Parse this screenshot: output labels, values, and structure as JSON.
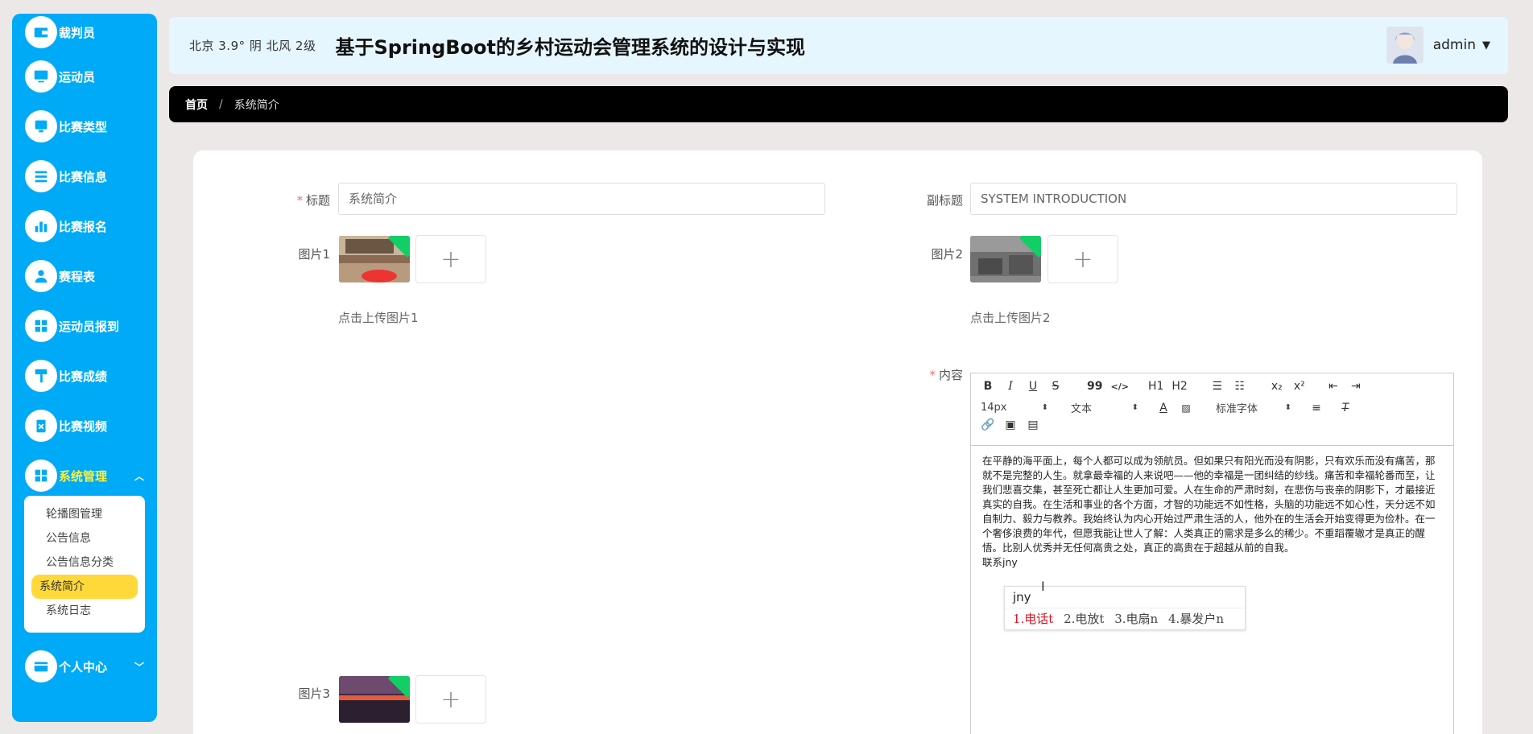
{
  "sidebar": {
    "items": [
      {
        "label": "裁判员",
        "icon": "wallet-icon"
      },
      {
        "label": "运动员",
        "icon": "monitor-icon"
      },
      {
        "label": "比赛类型",
        "icon": "screen-icon"
      },
      {
        "label": "比赛信息",
        "icon": "list-icon"
      },
      {
        "label": "比赛报名",
        "icon": "bar-chart-icon"
      },
      {
        "label": "赛程表",
        "icon": "user-icon"
      },
      {
        "label": "运动员报到",
        "icon": "grid-icon"
      },
      {
        "label": "比赛成绩",
        "icon": "paint-roller-icon"
      },
      {
        "label": "比赛视频",
        "icon": "clipboard-x-icon"
      },
      {
        "label": "系统管理",
        "icon": "grid-icon"
      },
      {
        "label": "个人中心",
        "icon": "card-icon"
      }
    ],
    "submenu": [
      "轮播图管理",
      "公告信息",
      "公告信息分类",
      "系统简介",
      "系统日志"
    ],
    "active_sub": "系统简介",
    "colors": {
      "bg": "#00aaf6",
      "active_text": "#ffef3a",
      "active_sub_bg": "#ffd93a"
    }
  },
  "header": {
    "weather": "北京  3.9°  阴  北风  2级",
    "title": "基于SpringBoot的乡村运动会管理系统的设计与实现",
    "user": "admin"
  },
  "breadcrumb": {
    "home": "首页",
    "sep": "/",
    "current": "系统简介"
  },
  "form": {
    "title_label": "标题",
    "title_value": "系统简介",
    "subtitle_label": "副标题",
    "subtitle_value": "SYSTEM INTRODUCTION",
    "pic1_label": "图片1",
    "pic1_hint": "点击上传图片1",
    "pic2_label": "图片2",
    "pic2_hint": "点击上传图片2",
    "pic3_label": "图片3",
    "content_label": "内容",
    "upload_plus": "+"
  },
  "editor": {
    "toolbar": {
      "bold": "B",
      "italic": "I",
      "underline": "U",
      "strike": "S",
      "quote": "99",
      "code": "</>",
      "h1": "H1",
      "h2": "H2",
      "sub": "x₂",
      "sup": "x²",
      "font_size": "14px",
      "block_type": "文本",
      "font_family": "标准字体"
    },
    "body": "在平静的海平面上，每个人都可以成为领航员。但如果只有阳光而没有阴影，只有欢乐而没有痛苦，那就不是完整的人生。就拿最幸福的人来说吧——他的幸福是一团纠结的纱线。痛苦和幸福轮番而至，让我们悲喜交集，甚至死亡都让人生更加可爱。人在生命的严肃时刻，在悲伤与丧亲的阴影下，才最接近真实的自我。在生活和事业的各个方面，才智的功能远不如性格，头脑的功能远不如心性，天分远不如自制力、毅力与教养。我始终认为内心开始过严肃生活的人，他外在的生活会开始变得更为俭朴。在一个奢侈浪费的年代，但愿我能让世人了解：人类真正的需求是多么的稀少。不重蹈覆辙才是真正的醒悟。比别人优秀并无任何高贵之处，真正的高贵在于超越从前的自我。",
    "typing": "联系jny"
  },
  "ime": {
    "input": "jny",
    "candidates": [
      "1.电话t",
      "2.电放t",
      "3.电扇n",
      "4.暴发户n"
    ]
  }
}
